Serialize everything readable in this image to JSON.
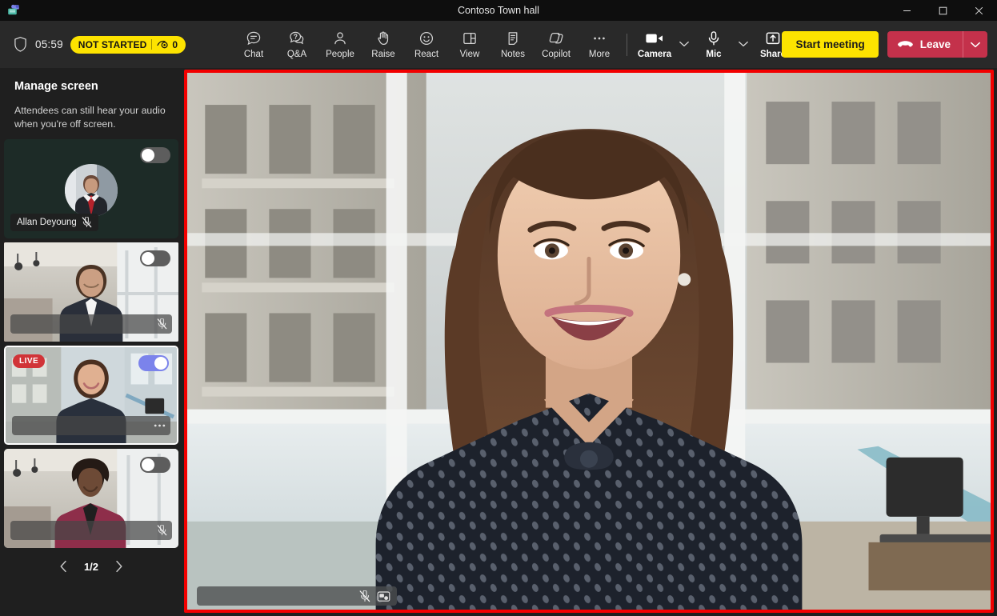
{
  "window": {
    "title": "Contoso Town hall",
    "app_icon": "teams-icon",
    "controls": {
      "minimize": "minimize-icon",
      "maximize": "maximize-icon",
      "close": "close-icon"
    }
  },
  "toolbar": {
    "shield_icon": "shield-icon",
    "timer": "05:59",
    "status_badge": {
      "label": "NOT STARTED",
      "eye_icon": "eye-icon",
      "viewer_count": "0"
    },
    "items": [
      {
        "label": "Chat",
        "icon": "chat-icon",
        "strong": false
      },
      {
        "label": "Q&A",
        "icon": "qa-icon",
        "strong": false
      },
      {
        "label": "People",
        "icon": "people-icon",
        "strong": false
      },
      {
        "label": "Raise",
        "icon": "raise-hand-icon",
        "strong": false
      },
      {
        "label": "React",
        "icon": "react-smiley-icon",
        "strong": false
      },
      {
        "label": "View",
        "icon": "view-layout-icon",
        "strong": false
      },
      {
        "label": "Notes",
        "icon": "notes-icon",
        "strong": false
      },
      {
        "label": "Copilot",
        "icon": "copilot-icon",
        "strong": false
      },
      {
        "label": "More",
        "icon": "more-ellipsis-icon",
        "strong": false
      }
    ],
    "media": [
      {
        "label": "Camera",
        "icon": "camera-on-icon",
        "has_caret": true
      },
      {
        "label": "Mic",
        "icon": "mic-icon",
        "has_caret": true
      },
      {
        "label": "Share",
        "icon": "share-screen-icon",
        "has_caret": false
      }
    ],
    "start_meeting_label": "Start meeting",
    "leave_label": "Leave",
    "leave_icon": "hangup-icon",
    "leave_caret_icon": "chevron-down-icon",
    "accent_yellow": "#fde300",
    "accent_red": "#c4314b"
  },
  "sidebar": {
    "title": "Manage screen",
    "description": "Attendees can still hear your audio when you're off screen.",
    "tiles": [
      {
        "name": "Allan Deyoung",
        "kind": "avatar",
        "toggle_on": false,
        "live": false,
        "selected": false,
        "annotated": false,
        "muted_icon": "mic-off-icon"
      },
      {
        "name": "",
        "kind": "video",
        "toggle_on": false,
        "live": false,
        "selected": false,
        "annotated": true,
        "muted_icon": "mic-off-icon"
      },
      {
        "name": "",
        "kind": "video",
        "toggle_on": true,
        "live": true,
        "live_label": "LIVE",
        "selected": true,
        "annotated": false,
        "muted_icon": "more-dots-icon"
      },
      {
        "name": "",
        "kind": "video",
        "toggle_on": false,
        "live": false,
        "selected": false,
        "annotated": false,
        "muted_icon": "mic-off-icon"
      }
    ],
    "pager": {
      "prev_icon": "chevron-left-icon",
      "page": "1/2",
      "next_icon": "chevron-right-icon"
    }
  },
  "stage": {
    "annotation_color": "#f20000",
    "namebar_icons": [
      "mic-off-icon",
      "pin-video-icon"
    ]
  }
}
